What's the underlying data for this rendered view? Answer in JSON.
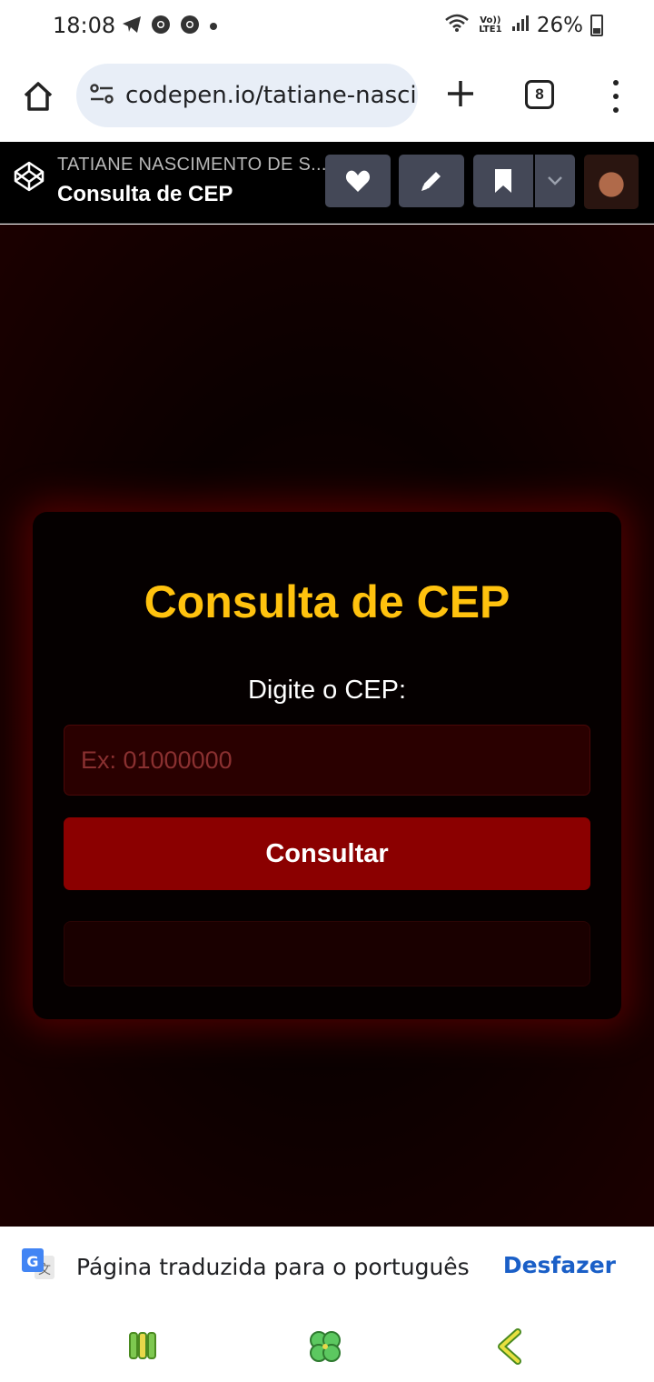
{
  "status_bar": {
    "time": "18:08",
    "network": "Vo)) LTE1",
    "battery": "26%"
  },
  "browser": {
    "url": "codepen.io/tatiane-nascimento",
    "tab_count": "8"
  },
  "codepen": {
    "author": "TATIANE NASCIMENTO DE S...",
    "pen_title": "Consulta de CEP"
  },
  "app": {
    "title": "Consulta de CEP",
    "label": "Digite o CEP:",
    "input_placeholder": "Ex: 01000000",
    "input_value": "",
    "button_label": "Consultar",
    "result": "",
    "colors": {
      "title": "#ffc20e",
      "button": "#8b0000",
      "background": "#0a0000"
    }
  },
  "translate_bar": {
    "message": "Página traduzida para o português",
    "undo_label": "Desfazer"
  },
  "nav": {
    "recent_icon": "recent-apps-icon",
    "home_icon": "clover-home-icon",
    "back_icon": "back-chevron-icon"
  }
}
